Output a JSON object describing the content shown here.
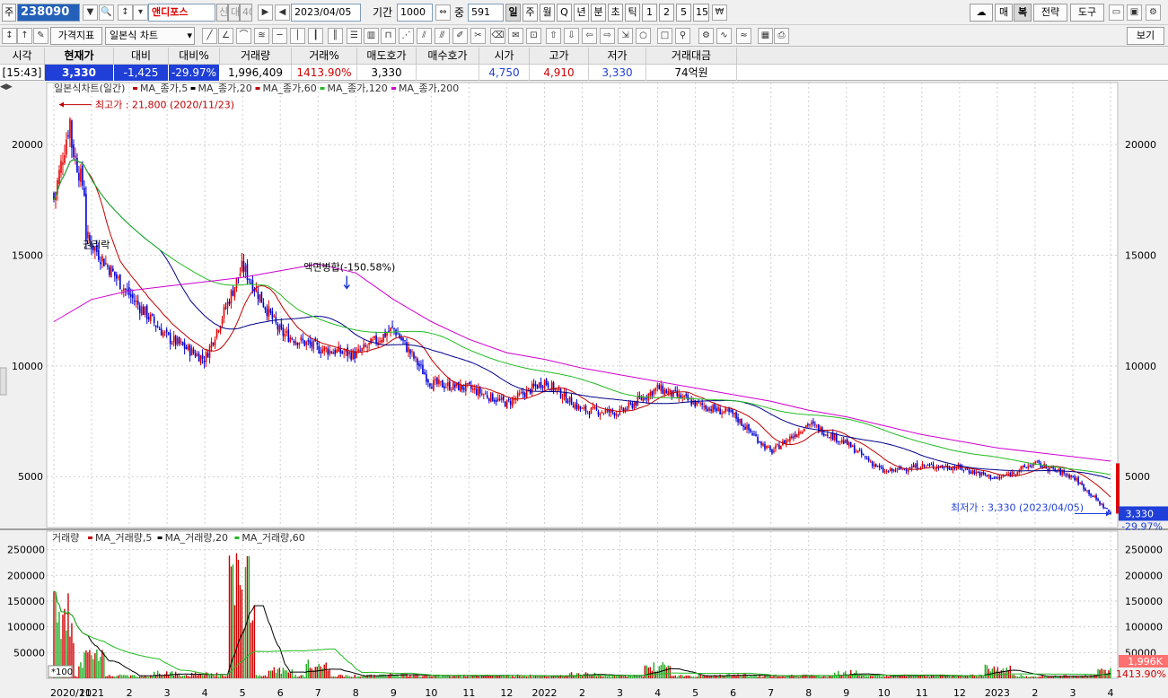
{
  "toolbar": {
    "market_label": "주",
    "code": "238090",
    "stock_name": "앤디포스",
    "badges": [
      "신",
      "대",
      "40"
    ],
    "date": "2023/04/05",
    "period_label": "기간",
    "period_value": "1000",
    "zoom_label": "중",
    "zoom_value": "591",
    "intervals": [
      "일",
      "주",
      "월",
      "Q",
      "년",
      "분",
      "초",
      "틱",
      "1",
      "2",
      "5",
      "15"
    ],
    "active_interval": "일",
    "right_buttons": [
      "매",
      "복",
      "전략",
      "도구"
    ],
    "price_indicator_btn": "가격지표",
    "chart_type": "일본식 차트",
    "view_btn": "보기"
  },
  "quote": {
    "headers": [
      "시각",
      "현재가",
      "대비",
      "대비%",
      "거래량",
      "거래%",
      "매도호가",
      "매수호가",
      "시가",
      "고가",
      "저가",
      "거래대금"
    ],
    "values": [
      "[15:43]",
      "3,330",
      "-1,425",
      "-29.97%",
      "1,996,409",
      "1413.90%",
      "3,330",
      "",
      "4,750",
      "4,910",
      "3,330",
      "74억원"
    ]
  },
  "chart_data": [
    {
      "type": "candlestick",
      "title": "일본식차트(일간)",
      "legend": [
        {
          "name": "MA_종가,5",
          "color": "#c00000"
        },
        {
          "name": "MA_종가,20",
          "color": "#000000"
        },
        {
          "name": "MA_종가,60",
          "color": "#c00000"
        },
        {
          "name": "MA_종가,120",
          "color": "#22bb22"
        },
        {
          "name": "MA_종가,200",
          "color": "#d000d0"
        }
      ],
      "ylim": [
        2700,
        22800
      ],
      "yticks": [
        5000,
        10000,
        15000,
        20000
      ],
      "ytick_labels": [
        "5000",
        "10000",
        "15000",
        "20000"
      ],
      "x": [
        "2020-11",
        "2021-01",
        "2021-02",
        "2021-03",
        "2021-04",
        "2021-05",
        "2021-06",
        "2021-07",
        "2021-08",
        "2021-09",
        "2021-10",
        "2021-11",
        "2021-12",
        "2022-01",
        "2022-02",
        "2022-03",
        "2022-04",
        "2022-05",
        "2022-06",
        "2022-07",
        "2022-08",
        "2022-09",
        "2022-10",
        "2022-11",
        "2022-12",
        "2023-01",
        "2023-02",
        "2023-03",
        "2023-04"
      ],
      "xtick_labels": [
        "2020/11",
        "2021",
        "2",
        "3",
        "4",
        "5",
        "6",
        "7",
        "8",
        "9",
        "10",
        "11",
        "12",
        "2022",
        "2",
        "3",
        "4",
        "5",
        "6",
        "7",
        "8",
        "9",
        "10",
        "11",
        "12",
        "2023",
        "2",
        "3",
        "4"
      ],
      "close_approx": [
        17800,
        15500,
        13200,
        11300,
        10300,
        14500,
        11500,
        10800,
        10500,
        11700,
        9200,
        9000,
        8300,
        9300,
        8000,
        7900,
        9000,
        8300,
        7800,
        6100,
        7400,
        6500,
        5200,
        5500,
        5400,
        4900,
        5600,
        5000,
        3330
      ],
      "ma200_approx": [
        12000,
        13000,
        13400,
        13600,
        13800,
        14000,
        14300,
        14600,
        14200,
        13000,
        12000,
        11200,
        10600,
        10300,
        9900,
        9600,
        9300,
        9000,
        8700,
        8400,
        8000,
        7700,
        7300,
        6900,
        6600,
        6300,
        6100,
        5900,
        5700
      ],
      "annotations": [
        {
          "text": "최고가 : 21,800 (2020/11/23)",
          "x": "2020-11-23",
          "y": 21800
        },
        {
          "text": "액면병합(-150.58%)",
          "x": "2021-07-20",
          "y": 13500
        },
        {
          "text": "최저가 : 3,330 (2023/04/05)",
          "x": "2023-04-05",
          "y": 3330
        },
        {
          "text": "권리락",
          "x": "2020-12-28",
          "y": 15000
        }
      ],
      "last_price_label": "3,330",
      "last_change_label": "-29.97%"
    },
    {
      "type": "bar",
      "title": "거래량",
      "legend": [
        {
          "name": "MA_거래량,5",
          "color": "#c00000"
        },
        {
          "name": "MA_거래량,20",
          "color": "#000000"
        },
        {
          "name": "MA_거래량,60",
          "color": "#22bb22"
        }
      ],
      "unit_label": "*100",
      "ylim": [
        0,
        265000
      ],
      "yticks": [
        50000,
        100000,
        150000,
        200000,
        250000
      ],
      "ytick_labels": [
        "50000",
        "100000",
        "150000",
        "200000",
        "250000"
      ],
      "x": [
        "2020-11",
        "2021-01",
        "2021-03",
        "2021-04",
        "2021-05",
        "2021-06",
        "2021-07",
        "2021-09",
        "2021-12",
        "2022-02",
        "2022-04",
        "2022-06",
        "2022-09",
        "2023-01",
        "2023-04"
      ],
      "values": [
        175000,
        60000,
        15000,
        12000,
        265000,
        22000,
        38000,
        10000,
        6000,
        12000,
        32000,
        10000,
        16000,
        28000,
        19964
      ],
      "last_volume_label": "1,996K",
      "last_volume_pct_label": "1413.90%"
    }
  ]
}
